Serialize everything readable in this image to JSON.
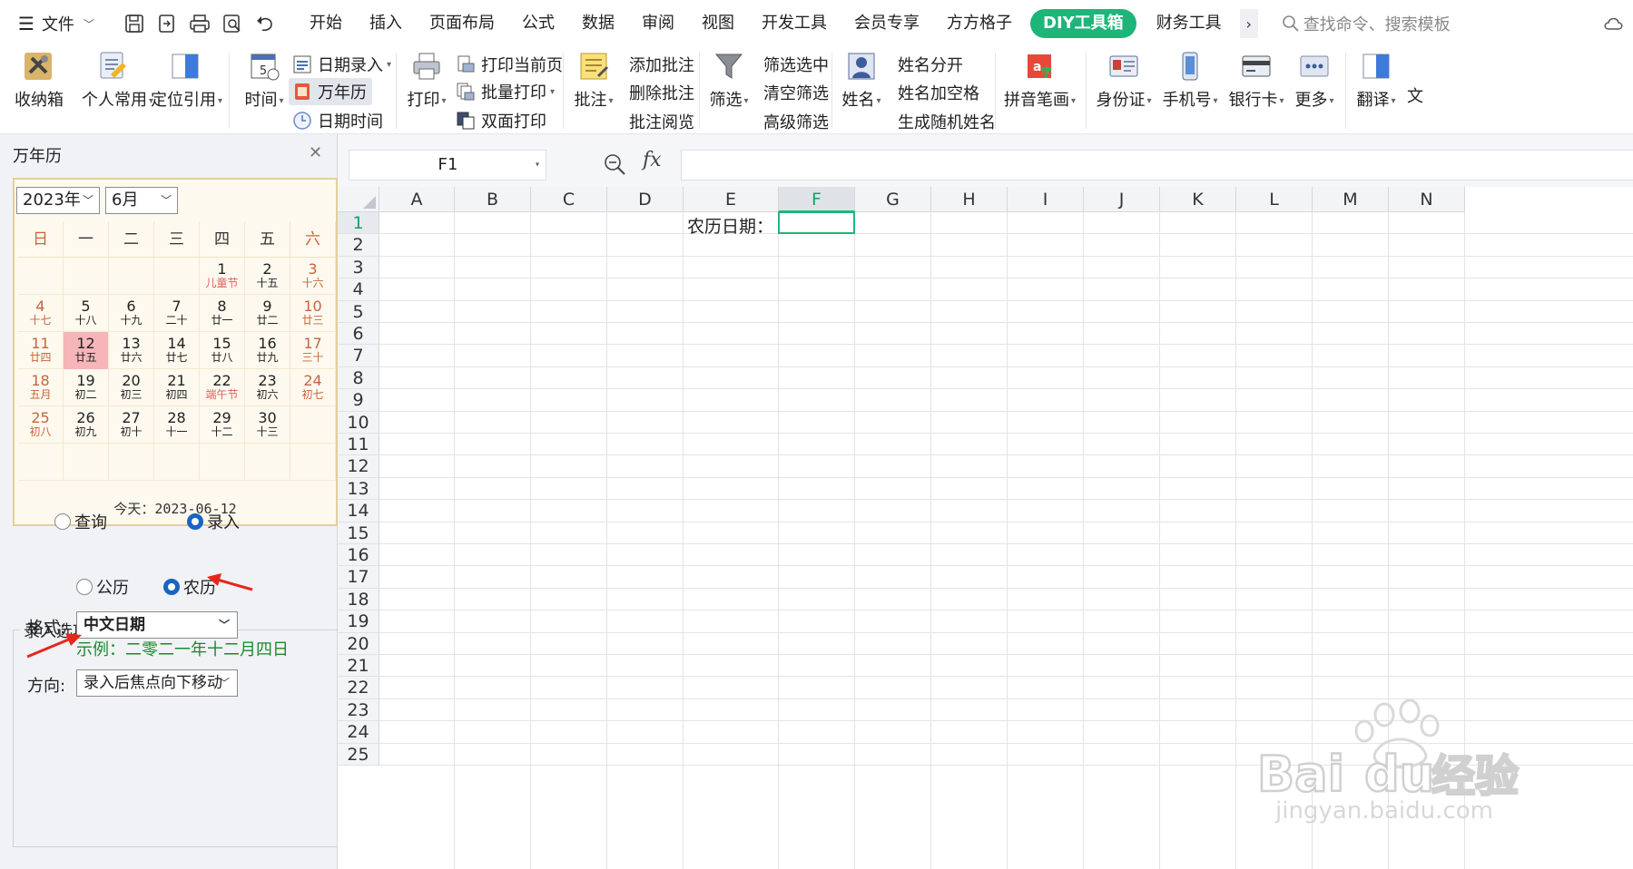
{
  "menubar": {
    "file_label": "文件",
    "tabs": [
      "开始",
      "插入",
      "页面布局",
      "公式",
      "数据",
      "审阅",
      "视图",
      "开发工具",
      "会员专享",
      "方方格子",
      "DIY工具箱",
      "财务工具"
    ],
    "active_tab": "DIY工具箱",
    "search_placeholder": "查找命令、搜索模板",
    "accent_color": "#1eb579"
  },
  "ribbon": {
    "shoucangxiang": "收纳箱",
    "gerenchangyong": "个人常用",
    "dingweiyinyong": "定位引用",
    "shijian": "时间",
    "riqiluru": "日期录入",
    "wannianli": "万年历",
    "riqishijian": "日期时间",
    "dayin": "打印",
    "dayindangqianye": "打印当前页",
    "piliangdayin": "批量打印",
    "shuangmiandayin": "双面打印",
    "pizhu": "批注",
    "tianjiapizhu": "添加批注",
    "shanchupizhu": "删除批注",
    "pizhuyuelan": "批注阅览",
    "shaixuan": "筛选",
    "shaixuanxuanzhong": "筛选选中",
    "qingkongshaixuan": "清空筛选",
    "gaojishaixuan": "高级筛选",
    "xingming": "姓名",
    "xingmingfenkai": "姓名分开",
    "xingmingjiakongge": "姓名加空格",
    "shengchengsuijixingming": "生成随机姓名",
    "pinyinbihua": "拼音笔画",
    "shenfenzheng": "身份证",
    "shoujihao": "手机号",
    "yinhangka": "银行卡",
    "gengduo": "更多",
    "fanyi": "翻译",
    "wen": "文"
  },
  "panel": {
    "title": "万年历",
    "year": "2023年",
    "month": "6月",
    "weekdays": [
      "日",
      "一",
      "二",
      "三",
      "四",
      "五",
      "六"
    ],
    "weeks": [
      [
        {
          "d": "",
          "l": ""
        },
        {
          "d": "",
          "l": ""
        },
        {
          "d": "",
          "l": ""
        },
        {
          "d": "",
          "l": ""
        },
        {
          "d": "1",
          "l": "儿童节",
          "fest": true
        },
        {
          "d": "2",
          "l": "十五"
        },
        {
          "d": "3",
          "l": "十六"
        }
      ],
      [
        {
          "d": "4",
          "l": "十七"
        },
        {
          "d": "5",
          "l": "十八"
        },
        {
          "d": "6",
          "l": "十九"
        },
        {
          "d": "7",
          "l": "二十"
        },
        {
          "d": "8",
          "l": "廿一"
        },
        {
          "d": "9",
          "l": "廿二"
        },
        {
          "d": "10",
          "l": "廿三"
        }
      ],
      [
        {
          "d": "11",
          "l": "廿四"
        },
        {
          "d": "12",
          "l": "廿五",
          "today": true
        },
        {
          "d": "13",
          "l": "廿六"
        },
        {
          "d": "14",
          "l": "廿七"
        },
        {
          "d": "15",
          "l": "廿八"
        },
        {
          "d": "16",
          "l": "廿九"
        },
        {
          "d": "17",
          "l": "三十"
        }
      ],
      [
        {
          "d": "18",
          "l": "五月"
        },
        {
          "d": "19",
          "l": "初二"
        },
        {
          "d": "20",
          "l": "初三"
        },
        {
          "d": "21",
          "l": "初四"
        },
        {
          "d": "22",
          "l": "端午节",
          "fest": true
        },
        {
          "d": "23",
          "l": "初六"
        },
        {
          "d": "24",
          "l": "初七"
        }
      ],
      [
        {
          "d": "25",
          "l": "初八"
        },
        {
          "d": "26",
          "l": "初九"
        },
        {
          "d": "27",
          "l": "初十"
        },
        {
          "d": "28",
          "l": "十一"
        },
        {
          "d": "29",
          "l": "十二"
        },
        {
          "d": "30",
          "l": "十三"
        },
        {
          "d": "",
          "l": ""
        }
      ],
      [
        {
          "d": "",
          "l": ""
        },
        {
          "d": "",
          "l": ""
        },
        {
          "d": "",
          "l": ""
        },
        {
          "d": "",
          "l": ""
        },
        {
          "d": "",
          "l": ""
        },
        {
          "d": "",
          "l": ""
        },
        {
          "d": "",
          "l": ""
        }
      ]
    ],
    "today_text": "今天：2023-06-12",
    "mode_query": "查询",
    "mode_entry": "录入",
    "mode_selected": "录入",
    "entry_options_label": "录入选项",
    "cal_gregorian": "公历",
    "cal_lunar": "农历",
    "cal_selected": "农历",
    "format_label": "格式:",
    "format_value": "中文日期",
    "example_text": "示例：二零二一年十二月四日",
    "direction_label": "方向:",
    "direction_value": "录入后焦点向下移动"
  },
  "sheet": {
    "name_box": "F1",
    "fx_label": "fx",
    "columns": [
      "A",
      "B",
      "C",
      "D",
      "E",
      "F",
      "G",
      "H",
      "I",
      "J",
      "K",
      "L",
      "M",
      "N"
    ],
    "selected_column": "F",
    "rows": [
      "1",
      "2",
      "3",
      "4",
      "5",
      "6",
      "7",
      "8",
      "9",
      "10",
      "11",
      "12",
      "13",
      "14",
      "15",
      "16",
      "17",
      "18",
      "19",
      "20",
      "21",
      "22",
      "23",
      "24",
      "25"
    ],
    "cell_E1": "农历日期："
  }
}
